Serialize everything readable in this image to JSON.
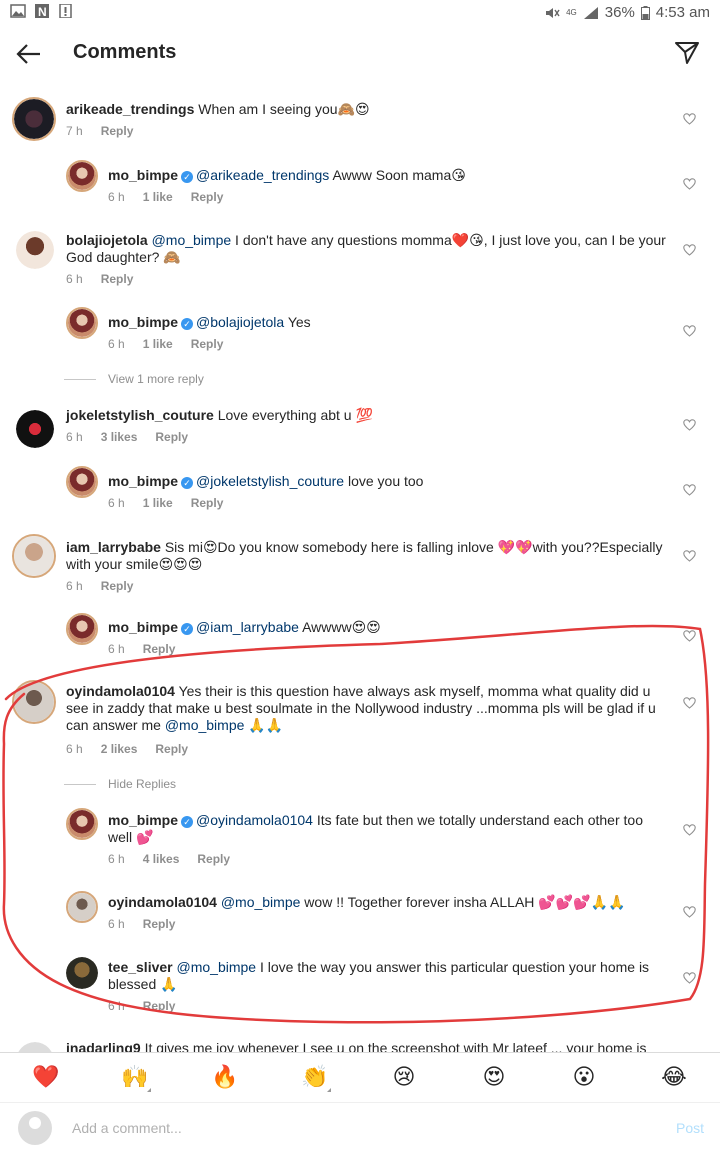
{
  "status_bar": {
    "battery": "36%",
    "time": "4:53 am",
    "network": "4G"
  },
  "header": {
    "title": "Comments"
  },
  "comments": [
    {
      "user": "arikeade_trendings",
      "text": "When am I seeing you🙈😍",
      "time": "7 h",
      "reply": "Reply"
    },
    {
      "user": "mo_bimpe",
      "mention": "@arikeade_trendings",
      "text": "Awww Soon mama😘",
      "time": "6 h",
      "likes": "1 like",
      "reply": "Reply"
    },
    {
      "user": "bolajiojetola",
      "mention": "@mo_bimpe",
      "text": "I don't have any questions momma❤️😘, I just love you, can I be your God daughter? 🙈",
      "time": "6 h",
      "reply": "Reply"
    },
    {
      "user": "mo_bimpe",
      "mention": "@bolajiojetola",
      "text": "Yes",
      "time": "6 h",
      "likes": "1 like",
      "reply": "Reply"
    },
    {
      "user": "jokeletstylish_couture",
      "text": "Love everything abt u 💯",
      "time": "6 h",
      "likes": "3 likes",
      "reply": "Reply"
    },
    {
      "user": "mo_bimpe",
      "mention": "@jokeletstylish_couture",
      "text": "love you too",
      "time": "6 h",
      "likes": "1 like",
      "reply": "Reply"
    },
    {
      "user": "iam_larrybabe",
      "text": "Sis mi😍Do you know somebody here is falling inlove 💖💖with you??Especially with your smile😍😍😍",
      "time": "6 h",
      "reply": "Reply"
    },
    {
      "user": "mo_bimpe",
      "mention": "@iam_larrybabe",
      "text": "Awwww😍😍",
      "time": "6 h",
      "reply": "Reply"
    },
    {
      "user": "oyindamola0104",
      "text": "Yes their is this question have always ask myself, momma what quality did u see in zaddy that make u best soulmate in the Nollywood industry ...momma pls will be glad if u can answer me",
      "mention_after": "@mo_bimpe",
      "text_after": "🙏🙏",
      "time": "6 h",
      "likes": "2 likes",
      "reply": "Reply"
    },
    {
      "user": "mo_bimpe",
      "mention": "@oyindamola0104",
      "text": "Its fate but then we totally understand each other too well 💕",
      "time": "6 h",
      "likes": "4 likes",
      "reply": "Reply"
    },
    {
      "user": "oyindamola0104",
      "mention": "@mo_bimpe",
      "text": "wow !! Together forever insha ALLAH 💕💕💕🙏🙏",
      "time": "6 h",
      "reply": "Reply"
    },
    {
      "user": "tee_sliver",
      "mention": "@mo_bimpe",
      "text": "I love the way you answer this particular question your home is blessed 🙏",
      "time": "6 h",
      "reply": "Reply"
    },
    {
      "user": "inadarling9",
      "text": "It gives me joy whenever I see u on the screenshot with Mr lateef ... your home is"
    }
  ],
  "view_more": "View 1 more reply",
  "hide_replies": "Hide Replies",
  "emoji_bar": [
    "❤️",
    "🙌",
    "🔥",
    "👏",
    "😢",
    "😍",
    "😮",
    "😂"
  ],
  "composer": {
    "placeholder": "Add a comment...",
    "post_label": "Post"
  },
  "colors": {
    "mention": "#00376b",
    "meta": "#8e8e8e",
    "verified": "#3897f0",
    "annotation": "#e23b3b"
  }
}
